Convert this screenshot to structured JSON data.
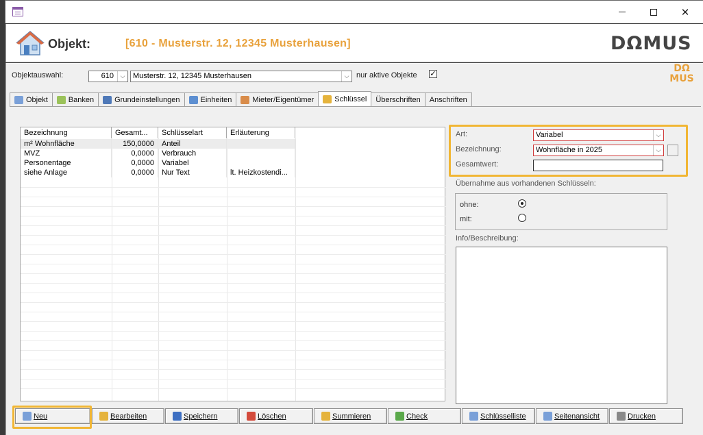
{
  "window": {
    "title": "",
    "minimize": "—",
    "maximize": "☐",
    "close": "✕"
  },
  "header": {
    "label": "Objekt:",
    "object_display": "[610 - Musterstr. 12, 12345 Musterhausen]",
    "brand": "DΩMUS"
  },
  "selector": {
    "label": "Objektauswahl:",
    "number": "610",
    "address": "Musterstr. 12, 12345 Musterhausen",
    "active_only_label": "nur aktive Objekte",
    "active_only_checked": "✓",
    "small_brand_top": "DΩ",
    "small_brand_bottom": "MUS"
  },
  "tabs": [
    {
      "label": "Objekt",
      "icon": "house-icon"
    },
    {
      "label": "Banken",
      "icon": "bank-icon"
    },
    {
      "label": "Grundeinstellungen",
      "icon": "settings-icon"
    },
    {
      "label": "Einheiten",
      "icon": "units-icon"
    },
    {
      "label": "Mieter/Eigentümer",
      "icon": "people-icon"
    },
    {
      "label": "Schlüssel",
      "icon": "key-icon",
      "active": true
    },
    {
      "label": "Überschriften",
      "icon": ""
    },
    {
      "label": "Anschriften",
      "icon": ""
    }
  ],
  "table": {
    "columns": [
      "Bezeichnung",
      "Gesamt...",
      "Schlüsselart",
      "Erläuterung"
    ],
    "rows": [
      [
        "m² Wohnfläche",
        "150,0000",
        "Anteil",
        ""
      ],
      [
        "MVZ",
        "0,0000",
        "Verbrauch",
        ""
      ],
      [
        "Personentage",
        "0,0000",
        "Variabel",
        ""
      ],
      [
        "siehe Anlage",
        "0,0000",
        "Nur Text",
        "lt. Heizkostendi..."
      ]
    ]
  },
  "form": {
    "art_label": "Art:",
    "art_value": "Variabel",
    "bezeichnung_label": "Bezeichnung:",
    "bezeichnung_value": "Wohnfläche in 2025",
    "gesamtwert_label": "Gesamtwert:",
    "gesamtwert_value": "",
    "uebernahme_label": "Übernahme aus vorhandenen Schlüsseln:",
    "ohne_label": "ohne:",
    "mit_label": "mit:",
    "info_label": "Info/Beschreibung:",
    "info_value": ""
  },
  "buttons": [
    {
      "label": "Neu",
      "icon": "new-doc-icon",
      "color": "#7aa0d8"
    },
    {
      "label": "Bearbeiten",
      "icon": "edit-icon",
      "color": "#e5b33c"
    },
    {
      "label": "Speichern",
      "icon": "save-icon",
      "color": "#3d6fc2"
    },
    {
      "label": "Löschen",
      "icon": "delete-icon",
      "color": "#d44b3c"
    },
    {
      "label": "Summieren",
      "icon": "sum-icon",
      "color": "#e5b33c"
    },
    {
      "label": "Check",
      "icon": "check-icon",
      "color": "#5aa84a"
    },
    {
      "label": "Schlüsselliste",
      "icon": "list-icon",
      "color": "#7aa0d8"
    },
    {
      "label": "Seitenansicht",
      "icon": "preview-icon",
      "color": "#7aa0d8"
    },
    {
      "label": "Drucken",
      "icon": "print-icon",
      "color": "#888888"
    }
  ],
  "colors": {
    "accent": "#e8a13b",
    "highlight": "#f1b634",
    "required_border": "#d03a3a"
  }
}
